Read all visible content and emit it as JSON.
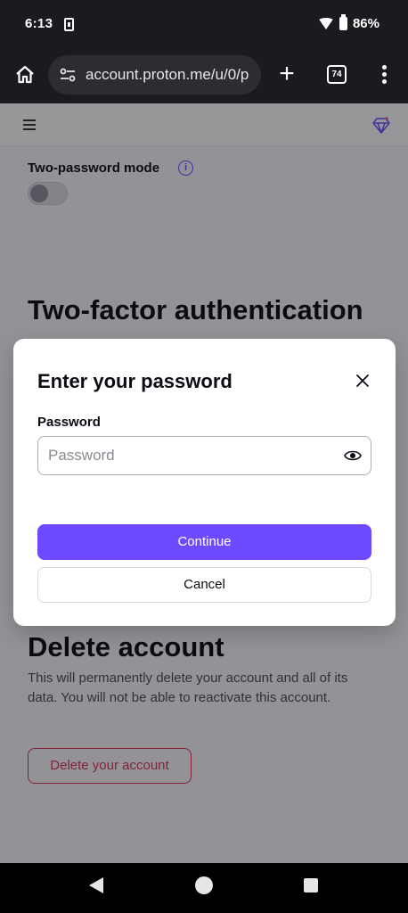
{
  "status_bar": {
    "time": "6:13",
    "battery": "86%"
  },
  "browser": {
    "url": "account.proton.me/u/0/p",
    "tab_count": "74"
  },
  "page": {
    "two_password_label": "Two-password mode",
    "two_password_enabled": false,
    "tfa_title": "Two-factor authentication",
    "delete_title": "Delete account",
    "delete_desc": "This will permanently delete your account and all of its data. You will not be able to reactivate this account.",
    "delete_button": "Delete your account"
  },
  "modal": {
    "title": "Enter your password",
    "password_label": "Password",
    "password_placeholder": "Password",
    "password_value": "",
    "continue_label": "Continue",
    "cancel_label": "Cancel"
  },
  "colors": {
    "accent": "#6d4aff",
    "danger": "#dc3251"
  }
}
